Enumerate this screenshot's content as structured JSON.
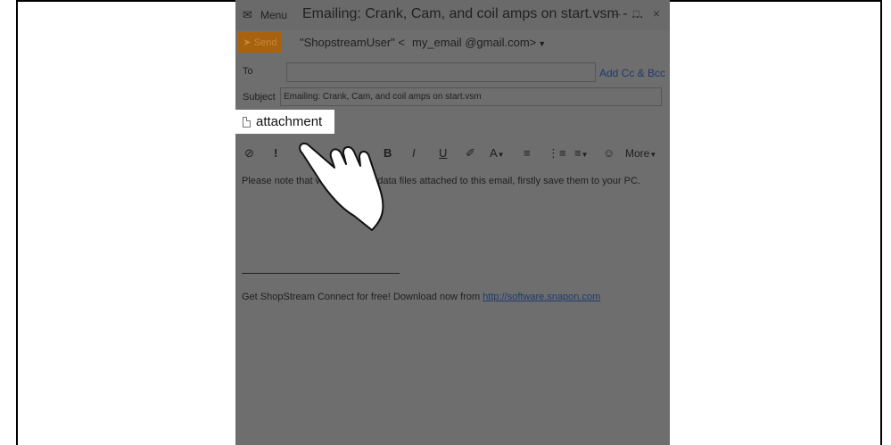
{
  "window": {
    "menu_label": "Menu",
    "title": "Emailing: Crank, Cam, and coil amps on start.vsm - ...",
    "minimize": "–",
    "maximize": "□",
    "close": "×"
  },
  "compose": {
    "send_label": "Send",
    "from_name": "\"ShopstreamUser\" <",
    "from_address": "my_email   @gmail.com>",
    "to_label": "To",
    "to_value": "",
    "add_cc_bcc": "Add Cc & Bcc",
    "subject_label": "Subject",
    "subject_value": "Emailing: Crank, Cam, and coil amps on start.vsm",
    "attachment_label": "attachment"
  },
  "toolbar": {
    "attach": "⊘",
    "importance": "!",
    "bold": "B",
    "italic": "I",
    "underline": "U",
    "highlight": "✐",
    "font_color": "A",
    "bullets": "≡",
    "numbering": "⋮≡",
    "align": "≡",
    "emoji": "☺",
    "more": "More"
  },
  "body": {
    "message": "Please note that          view Snap-on data files attached to this email, firstly save them to your PC.",
    "footer_prefix": "Get ShopStream Connect for free! Download now from",
    "footer_link": "http://software.snapon.com"
  },
  "colors": {
    "overlay": "#6e6e6e",
    "send_accent": "#a8620e",
    "link": "#1d3a6e"
  }
}
